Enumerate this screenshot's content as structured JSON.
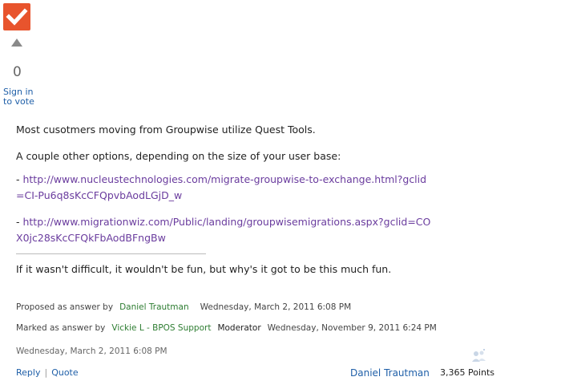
{
  "vote": {
    "count": "0",
    "sign_in_line1": "Sign in",
    "sign_in_line2": "to vote"
  },
  "post": {
    "line1": "Most cusotmers moving from Groupwise utilize Quest Tools.",
    "line2": "A couple other options, depending on the size of your user base:",
    "link1_prefix": "- ",
    "link1_text": "http://www.nucleustechnologies.com/migrate-groupwise-to-exchange.html?gclid=CI-Pu6q8sKcCFQpvbAodLGjD_w",
    "link2_prefix": "- ",
    "link2_text": "http://www.migrationwiz.com/Public/landing/groupwisemigrations.aspx?gclid=COX0jc28sKcCFQkFbAodBFngBw",
    "signature": "If it wasn't difficult, it wouldn't be fun, but why's it got to be this much fun."
  },
  "meta": {
    "proposed_label": "Proposed as answer by",
    "proposed_user": "Daniel Trautman",
    "proposed_date": "Wednesday, March 2, 2011 6:08 PM",
    "marked_label": "Marked as answer by",
    "marked_user": "Vickie L - BPOS Support",
    "marked_role": "Moderator",
    "marked_date": "Wednesday, November 9, 2011 6:24 PM",
    "post_date": "Wednesday, March 2, 2011 6:08 PM"
  },
  "footer": {
    "reply_label": "Reply",
    "separator": "|",
    "quote_label": "Quote",
    "author_name": "Daniel Trautman",
    "points": "3,365 Points"
  },
  "icons": {
    "answer_mark": "checkmark-icon",
    "vote_up": "vote-up-arrow-icon",
    "avatar": "avatar-icon"
  },
  "colors": {
    "answer_mark": "#e8542d",
    "link": "#1f5fa8",
    "post_link": "#6a3c9e",
    "user_green": "#2e7d32"
  }
}
